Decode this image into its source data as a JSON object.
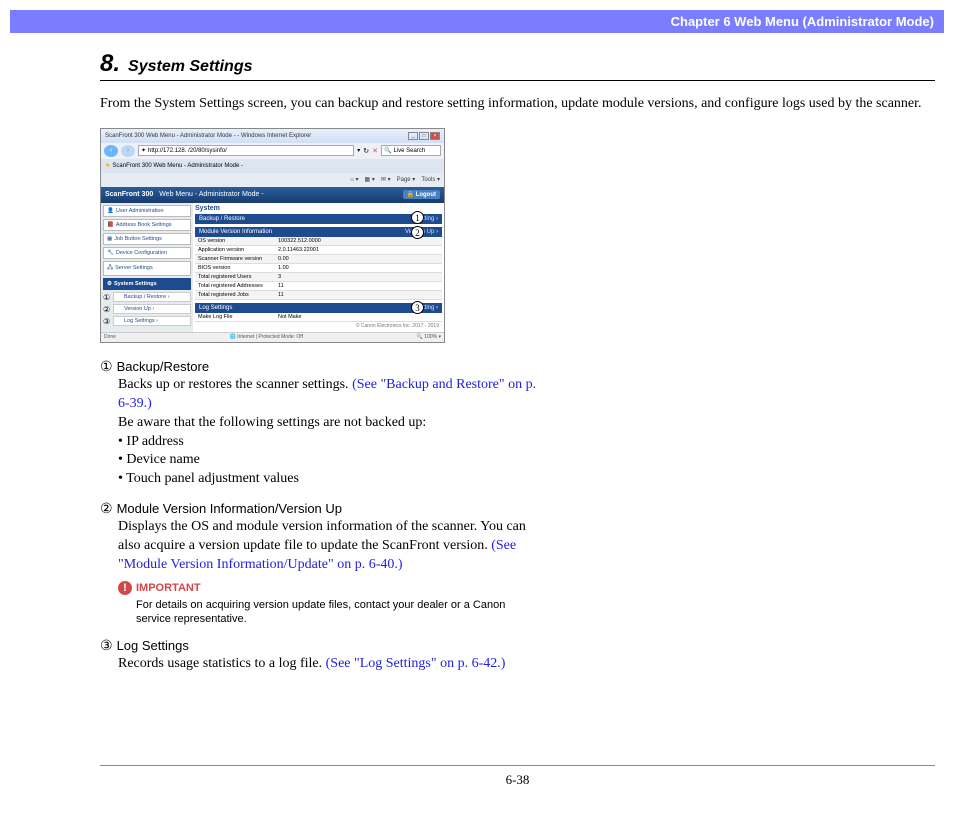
{
  "header": {
    "chapter": "Chapter 6   Web Menu (Administrator Mode)"
  },
  "section": {
    "number": "8.",
    "title": "System Settings"
  },
  "intro": "From the System Settings screen, you can backup and restore setting information, update module versions, and configure logs used by the scanner.",
  "figure": {
    "ie_title": "ScanFront 300 Web Menu - Administrator Mode - - Windows Internet Explorer",
    "url": "http://172.128. /20/80/sysinfo/",
    "search_hint": "Live Search",
    "tab": "ScanFront 300 Web Menu - Administrator Mode -",
    "toolbar": {
      "page": "Page ▾",
      "tools": "Tools ▾"
    },
    "app_title_left": "ScanFront 300",
    "app_title_mid": "Web Menu    - Administrator Mode -",
    "logout": "Logout",
    "sidebar": {
      "items": [
        "User Administration",
        "Address Book Settings",
        "Job Button Settings",
        "Device Configuration",
        "Server Settings",
        "System Settings"
      ],
      "subs": [
        "Backup / Restore ›",
        "Version Up ›",
        "Log Settings ›"
      ]
    },
    "sub_marks": [
      "①",
      "②",
      "③"
    ],
    "panels": {
      "system": "System",
      "bar1_left": "Backup / Restore",
      "bar1_right": "Setting ›",
      "bar2_left": "Module Version Information",
      "bar2_right": "Version Up ›",
      "rows": [
        {
          "label": "OS version",
          "value": "100322.512.0000"
        },
        {
          "label": "Application version",
          "value": "2.0.11463.22001"
        },
        {
          "label": "Scanner Firmware version",
          "value": "0.00"
        },
        {
          "label": "BIOS version",
          "value": "1.00"
        },
        {
          "label": "Total registered Users",
          "value": "3"
        },
        {
          "label": "Total registered Addresses",
          "value": "11"
        },
        {
          "label": "Total registered Jobs",
          "value": "11"
        }
      ],
      "bar3_left": "Log Settings",
      "bar3_right": "Setting ›",
      "log_row_label": "Make Log File",
      "log_row_value": "Not Make"
    },
    "copyright": "© Canon Electronics Inc. 2017 - 2019",
    "status_left": "Done",
    "status_mid": "Internet | Protected Mode: Off",
    "status_right": "100%"
  },
  "items": {
    "i1": {
      "mark": "①",
      "title": "Backup/Restore",
      "p1": "Backs up or restores the scanner settings. ",
      "link1": "(See \"Backup and Restore\" on p. 6-39.)",
      "p2": "Be aware that the following settings are not backed up:",
      "b1": "IP address",
      "b2": "Device name",
      "b3": "Touch panel adjustment values"
    },
    "i2": {
      "mark": "②",
      "title": "Module Version Information/Version Up",
      "p1": "Displays the OS and module version information of the scanner. You can also acquire a version update file to update the ScanFront version. ",
      "link1": "(See \"Module Version Information/Update\" on p. 6-40.)",
      "important_label": "IMPORTANT",
      "important_text": "For details on acquiring version update files, contact your dealer or a Canon service representative."
    },
    "i3": {
      "mark": "③",
      "title": "Log Settings",
      "p1": "Records usage statistics to a log file. ",
      "link1": "(See \"Log Settings\" on p. 6-42.)"
    }
  },
  "footer": {
    "page": "6-38"
  }
}
